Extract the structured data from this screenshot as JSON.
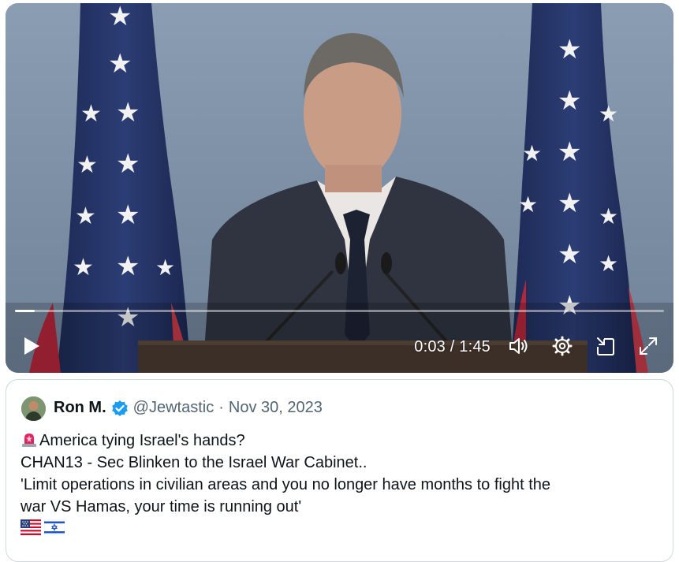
{
  "video": {
    "time_current": "0:03",
    "time_separator": " / ",
    "time_total": "1:45",
    "progress_fraction": 0.03,
    "icons": {
      "play": "play-icon",
      "volume": "volume-icon",
      "settings": "gear-icon",
      "minimize": "pip-icon",
      "fullscreen": "fullscreen-icon"
    }
  },
  "quote": {
    "author_name": "Ron M.",
    "handle": "@Jewtastic",
    "separator": "·",
    "date": "Nov 30, 2023",
    "lines": [
      "America tying Israel's hands?",
      "CHAN13 - Sec Blinken to the Israel War Cabinet..",
      "'Limit operations in civilian areas and you no longer have months to fight the",
      "war VS Hamas, your time is running out'"
    ],
    "emojis": [
      "siren-emoji",
      "us-flag-emoji",
      "israel-flag-emoji"
    ]
  },
  "colors": {
    "accent_verified": "#1d9bf0",
    "text_primary": "#0f1419",
    "text_secondary": "#536471",
    "border": "#cfd9de"
  }
}
